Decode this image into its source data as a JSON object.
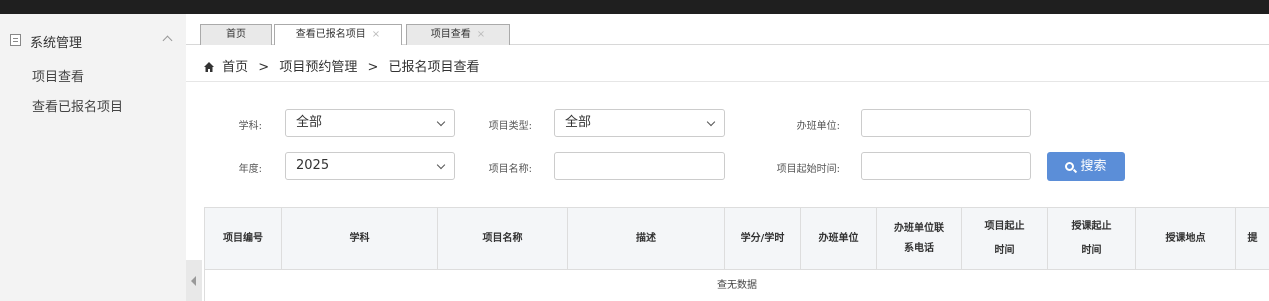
{
  "sidebar": {
    "header": "系统管理",
    "items": [
      {
        "label": "项目查看"
      },
      {
        "label": "查看已报名项目"
      }
    ]
  },
  "tabs": [
    {
      "label": "首页",
      "closable": false,
      "active": false
    },
    {
      "label": "查看已报名项目",
      "closable": true,
      "active": true
    },
    {
      "label": "项目查看",
      "closable": true,
      "active": false
    }
  ],
  "tab_close_glyph": "×",
  "breadcrumb": {
    "items": [
      "首页",
      "项目预约管理",
      "已报名项目查看"
    ],
    "separator": ">"
  },
  "filters": {
    "subject": {
      "label": "学科:",
      "value": "全部"
    },
    "project_type": {
      "label": "项目类型:",
      "value": "全部"
    },
    "organizer": {
      "label": "办班单位:",
      "value": ""
    },
    "year": {
      "label": "年度:",
      "value": "2025"
    },
    "project_name": {
      "label": "项目名称:",
      "value": ""
    },
    "start_time": {
      "label": "项目起始时间:",
      "value": ""
    },
    "search_button": "搜索"
  },
  "table": {
    "columns": [
      "项目编号",
      "学科",
      "项目名称",
      "描述",
      "学分/学时",
      "办班单位",
      "办班单位联\n系电话",
      "项目起止\n时间",
      "授课起止\n时间",
      "授课地点",
      "提"
    ],
    "empty_text": "查无数据"
  },
  "colors": {
    "accent": "#5b8ed8",
    "sidebar_bg": "#f3f3f3",
    "topbar_bg": "#1f1f1f",
    "header_bg": "#f4f6f8"
  },
  "icons": {
    "sidebar_header": "document-icon",
    "collapse": "chevron-up-icon",
    "breadcrumb_home": "home-icon",
    "search": "search-icon",
    "sidebar_toggle": "caret-left-icon"
  }
}
